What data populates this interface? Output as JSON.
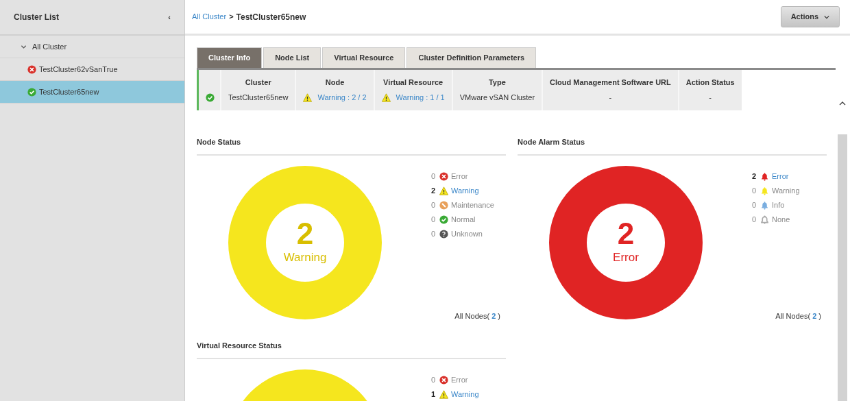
{
  "sidebar": {
    "title": "Cluster List",
    "collapse_glyph": "‹",
    "tree": [
      {
        "label": "All Cluster",
        "expanded": true,
        "children": [
          {
            "label": "TestCluster62vSanTrue",
            "kind": "error",
            "selected": false
          },
          {
            "label": "TestCluster65new",
            "kind": "normal",
            "selected": true
          }
        ]
      }
    ]
  },
  "header": {
    "breadcrumb": [
      {
        "label": "All Cluster",
        "link": true
      },
      {
        "label": "TestCluster65new",
        "link": false
      }
    ],
    "separator": ">",
    "actions_button": "Actions"
  },
  "tabs": [
    {
      "label": "Cluster Info",
      "selected": true
    },
    {
      "label": "Node List",
      "selected": false
    },
    {
      "label": "Virtual Resource",
      "selected": false
    },
    {
      "label": "Cluster Definition Parameters",
      "selected": false
    }
  ],
  "info_table": {
    "kind": "normal",
    "columns": [
      "Cluster",
      "Node",
      "Virtual Resource",
      "Type",
      "Cloud Management Software URL",
      "Action Status"
    ],
    "cells": [
      {
        "text": "TestCluster65new",
        "link": false
      },
      {
        "text": "Warning : 2 / 2",
        "link": true,
        "kind": "warning"
      },
      {
        "text": "Warning : 1 / 1",
        "link": true,
        "kind": "warning"
      },
      {
        "text": "VMware vSAN Cluster",
        "link": false
      },
      {
        "text": "-",
        "link": false
      },
      {
        "text": "-",
        "link": false
      }
    ]
  },
  "panels": [
    {
      "title": "Node Status",
      "center_value": "2",
      "center_label": "Warning",
      "footer": {
        "label": "All Nodes(",
        "count": "2",
        "close": ")"
      },
      "legend": [
        {
          "count": "0",
          "label": "Error",
          "kind": "error",
          "color": "#d9312b",
          "link": false
        },
        {
          "count": "2",
          "label": "Warning",
          "kind": "warning",
          "color": "#f5e61e",
          "link": true
        },
        {
          "count": "0",
          "label": "Maintenance",
          "kind": "maintenance",
          "color": "#e8a05a",
          "link": false
        },
        {
          "count": "0",
          "label": "Normal",
          "kind": "normal",
          "color": "#3aaa35",
          "link": false
        },
        {
          "count": "0",
          "label": "Unknown",
          "kind": "unknown",
          "color": "#555555",
          "link": false
        }
      ]
    },
    {
      "title": "Node Alarm Status",
      "center_value": "2",
      "center_label": "Error",
      "footer": {
        "label": "All Nodes(",
        "count": "2",
        "close": ")"
      },
      "legend": [
        {
          "count": "2",
          "label": "Error",
          "kind": "bell",
          "color": "#e02424",
          "link": true
        },
        {
          "count": "0",
          "label": "Warning",
          "kind": "bell",
          "color": "#f5e61e",
          "link": false
        },
        {
          "count": "0",
          "label": "Info",
          "kind": "bell",
          "color": "#7aaee0",
          "link": false
        },
        {
          "count": "0",
          "label": "None",
          "kind": "bell-outline",
          "color": "#aaaaaa",
          "link": false
        }
      ]
    },
    {
      "title": "Virtual Resource Status",
      "legend": [
        {
          "count": "0",
          "label": "Error",
          "kind": "error",
          "color": "#d9312b",
          "link": false
        },
        {
          "count": "1",
          "label": "Warning",
          "kind": "warning",
          "color": "#f5e61e",
          "link": true
        }
      ]
    }
  ]
}
